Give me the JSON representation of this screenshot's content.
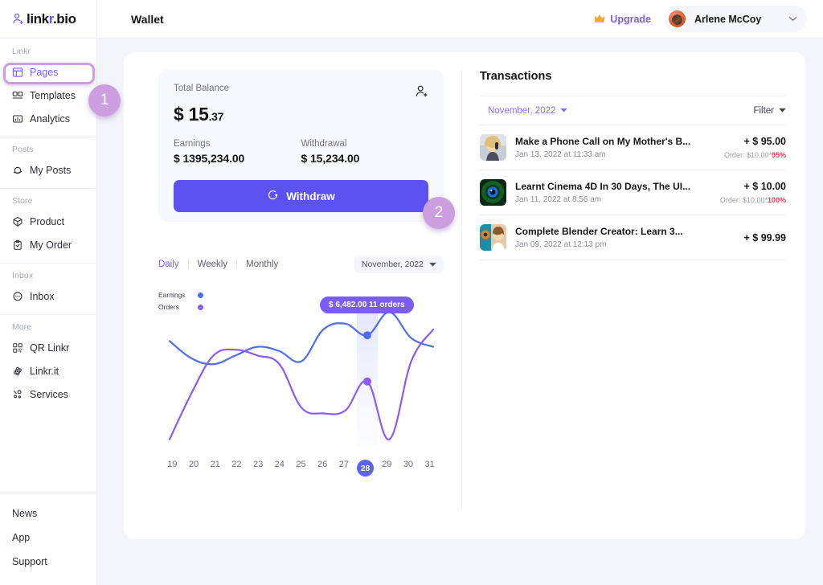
{
  "brand": {
    "text_a": "link",
    "text_r": "r",
    "text_b": ".bio",
    "icon": "user-logo-icon"
  },
  "header": {
    "title": "Wallet",
    "upgrade_label": "Upgrade",
    "crown_icon": "crown-icon",
    "user_name": "Arlene McCoy",
    "chevron": "⌄"
  },
  "sidebar": {
    "groups": [
      {
        "label": "Linkr",
        "items": [
          {
            "label": "Pages",
            "icon": "layout-icon",
            "active": true
          },
          {
            "label": "Templates",
            "icon": "templates-icon",
            "active": false
          },
          {
            "label": "Analytics",
            "icon": "analytics-icon",
            "active": false
          }
        ]
      },
      {
        "label": "Posts",
        "items": [
          {
            "label": "My Posts",
            "icon": "saturn-icon",
            "active": false
          }
        ]
      },
      {
        "label": "Store",
        "items": [
          {
            "label": "Product",
            "icon": "box-icon",
            "active": false
          },
          {
            "label": "My Order",
            "icon": "clipboard-check-icon",
            "active": false
          }
        ]
      },
      {
        "label": "Inbox",
        "items": [
          {
            "label": "Inbox",
            "icon": "chat-icon",
            "active": false
          }
        ]
      },
      {
        "label": "More",
        "items": [
          {
            "label": "QR Linkr",
            "icon": "qr-icon",
            "active": false
          },
          {
            "label": "Linkr.it",
            "icon": "atom-icon",
            "active": false
          },
          {
            "label": "Services",
            "icon": "services-icon",
            "active": false
          }
        ]
      }
    ],
    "footer": [
      "News",
      "App",
      "Support"
    ]
  },
  "balance": {
    "label": "Total Balance",
    "currency": "$",
    "whole": "15",
    "cents": ".37",
    "add_user_icon": "add-user-icon",
    "earnings_label": "Earnings",
    "earnings_value": "$ 1395,234.00",
    "withdrawal_label": "Withdrawal",
    "withdrawal_value": "$ 15,234.00",
    "withdraw_button": "Withdraw",
    "withdraw_icon": "refresh-circle-icon"
  },
  "chart_panel": {
    "tabs": [
      {
        "label": "Daily",
        "active": true
      },
      {
        "label": "Weekly",
        "active": false
      },
      {
        "label": "Monthly",
        "active": false
      }
    ],
    "month_select": "November, 2022",
    "legend": [
      {
        "label": "Earnings",
        "color": "#4f6cf0"
      },
      {
        "label": "Orders",
        "color": "#8a5cf0"
      }
    ],
    "tooltip": "$ 6,482.00 11 orders"
  },
  "chart_data": {
    "type": "line",
    "title": "",
    "xlabel": "",
    "ylabel": "",
    "x": [
      19,
      20,
      21,
      22,
      23,
      24,
      25,
      26,
      27,
      28,
      29,
      30,
      31
    ],
    "selected_x": 28,
    "highlight_band": {
      "from": 27.5,
      "to": 28.5
    },
    "annotation": {
      "x": 28,
      "text": "$ 6,482.00 11 orders",
      "value": 6482.0,
      "orders": 11
    },
    "series": [
      {
        "name": "Earnings",
        "color": "#4f6cf0",
        "values": [
          72,
          60,
          56,
          62,
          68,
          65,
          58,
          80,
          84,
          76,
          92,
          74,
          68
        ]
      },
      {
        "name": "Orders",
        "color": "#8a5cf0",
        "values": [
          4,
          36,
          62,
          66,
          62,
          56,
          26,
          22,
          24,
          44,
          4,
          58,
          80
        ]
      }
    ],
    "ylim": [
      0,
      100
    ],
    "grid": false,
    "legend_position": "top-left"
  },
  "transactions": {
    "title": "Transactions",
    "month_filter": "November, 2022",
    "filter_label": "Filter",
    "rows": [
      {
        "name": "Make a Phone Call on My Mother's B...",
        "date": "Jan 13, 2022 at 11:33 am",
        "amount": "+ $ 95.00",
        "order": "Order: $10.00*",
        "percent": "95%",
        "thumb": "woman-on-phone-thumb"
      },
      {
        "name": "Learnt Cinema 4D In 30 Days, The UI...",
        "date": "Jan 11, 2022 at 8:56 am",
        "amount": "+ $ 10.00",
        "order": "Order: $10.00*",
        "percent": "100%",
        "thumb": "cinema4d-logo-thumb"
      },
      {
        "name": "Complete Blender Creator: Learn 3...",
        "date": "Jan 09, 2022 at 12:13 pm",
        "amount": "+ $ 99.99",
        "order": "",
        "percent": "",
        "thumb": "blender-course-thumb"
      }
    ]
  },
  "annotations": [
    {
      "id": "1",
      "label": "1"
    },
    {
      "id": "2",
      "label": "2"
    }
  ],
  "colors": {
    "accent_purple": "#7b5cf5",
    "button_blue": "#5b52f0",
    "earnings_line": "#4f6cf0",
    "orders_line": "#8a5cf0",
    "badge_pink": "#cb9ee0",
    "danger_red": "#f2365a"
  }
}
